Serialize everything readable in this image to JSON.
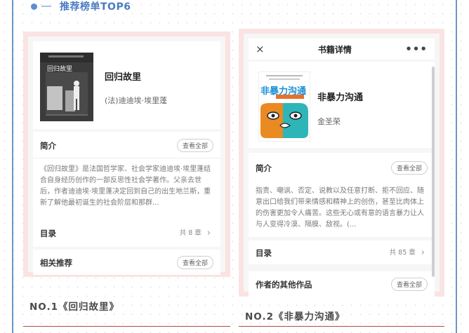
{
  "header": {
    "title": "推荐榜单TOP6"
  },
  "books": [
    {
      "title": "回归故里",
      "author": "(法)迪迪埃·埃里蓬",
      "cover_title": "回归故里",
      "intro_label": "简介",
      "view_all": "查看全部",
      "description": "《回归故里》是法国哲学家、社会学家迪迪埃·埃里蓬结合自身经历创作的一部反思性社会学著作。父亲去世后，作者迪迪埃·埃里蓬决定回到自己的出生地兰斯，重新了解他最初诞生的社会阶层和那群...",
      "toc_label": "目录",
      "chapter_count": "共 8 章",
      "related_label": "相关推荐",
      "related_view_all": "查看全部",
      "caption": "NO.1《回归故里》"
    },
    {
      "navbar_title": "书籍详情",
      "title": "非暴力沟通",
      "author": "金圣荣",
      "cover_title": "非暴力沟通",
      "intro_label": "简介",
      "view_all": "查看全部",
      "description": "指责、嘲讽、否定、说教以及任意打断、拒不回应、随意出口给我们带来情感和精神上的创伤，甚至比肉体上的伤害更加令人痛苦。这些无心或有意的语言暴力让人与人变得冷漠、隔膜、敌视。(...",
      "toc_label": "目录",
      "chapter_count": "共 85 章",
      "other_works_label": "作者的其他作品",
      "other_view_all": "查看全部",
      "caption": "NO.2《非暴力沟通》"
    }
  ],
  "icons": {
    "close": "×",
    "more": "•••",
    "chevron": "›"
  },
  "colors": {
    "accent": "#4a7cc2",
    "card_border": "#fbe3e3",
    "underline": "#b24c3e"
  }
}
